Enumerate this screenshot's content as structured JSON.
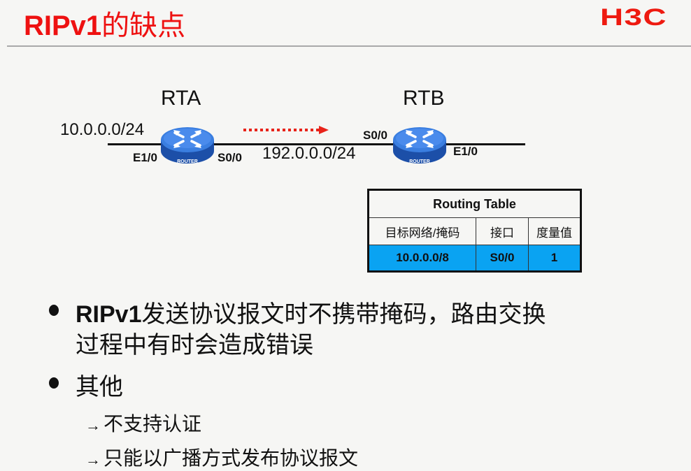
{
  "slide": {
    "title_latin": "RIPv1",
    "title_cjk": "的缺点",
    "logo": "H3C",
    "colors": {
      "title": "#ee1111",
      "logo": "#ee1a10",
      "table_highlight": "#0aa3f2",
      "router_body": "#2f6fd0",
      "arrow": "#e8231a",
      "background": "#f6f6f4"
    }
  },
  "diagram": {
    "rta": {
      "name": "RTA",
      "icon": "router-icon",
      "icon_label": "ROUTER",
      "left_iface": "E1/0",
      "right_iface": "S0/0"
    },
    "rtb": {
      "name": "RTB",
      "icon": "router-icon",
      "icon_label": "ROUTER",
      "left_iface": "S0/0",
      "right_iface": "E1/0"
    },
    "left_network": "10.0.0.0/24",
    "middle_network": "192.0.0.0/24",
    "arrow": "dotted-arrow-right"
  },
  "routing_table": {
    "caption": "Routing Table",
    "headers": [
      "目标网络/掩码",
      "接口",
      "度量值"
    ],
    "rows": [
      [
        "10.0.0.0/8",
        "S0/0",
        "1"
      ]
    ]
  },
  "bullets": [
    {
      "bold": "RIPv1",
      "text_line1": "发送协议报文时不携带掩码，路由交换",
      "text_line2": "过程中有时会造成错误"
    },
    {
      "text": "其他",
      "subitems": [
        "不支持认证",
        "只能以广播方式发布协议报文"
      ]
    }
  ]
}
